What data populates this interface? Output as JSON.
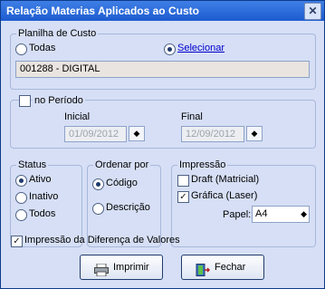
{
  "window": {
    "title": "Relação Materias Aplicados ao Custo"
  },
  "planilha": {
    "legend": "Planilha de Custo",
    "option_all": "Todas",
    "option_select": "Selecionar",
    "selected": "select",
    "value": "001288 - DIGITAL"
  },
  "periodo": {
    "label": "no Período",
    "checked": false,
    "start_label": "Inicial",
    "start_value": "01/09/2012",
    "end_label": "Final",
    "end_value": "12/09/2012"
  },
  "status": {
    "legend": "Status",
    "options": [
      "Ativo",
      "Inativo",
      "Todos"
    ],
    "selected": "Ativo"
  },
  "ordenar": {
    "legend": "Ordenar por",
    "options": [
      "Código",
      "Descrição"
    ],
    "selected": "Código"
  },
  "impressao": {
    "legend": "Impressão",
    "draft_label": "Draft (Matricial)",
    "draft_checked": false,
    "grafica_label": "Gráfica (Laser)",
    "grafica_checked": true,
    "paper_label": "Papel:",
    "paper_value": "A4"
  },
  "diferenca": {
    "label": "Impressão da Diferença de Valores",
    "checked": true
  },
  "buttons": {
    "print": "Imprimir",
    "close": "Fechar"
  },
  "icons": {
    "close": "close-icon",
    "spin": "spin-button-icon",
    "print": "printer-icon",
    "exit": "exit-door-icon"
  },
  "colors": {
    "titlebar": "#1d5bd0",
    "dialog_bg": "#d6dff5",
    "link": "#0000cc"
  }
}
